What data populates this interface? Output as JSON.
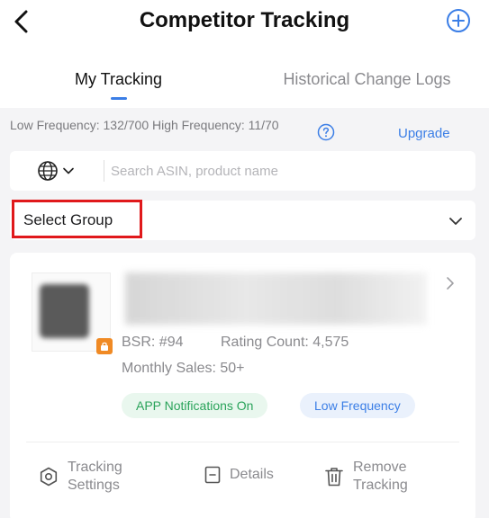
{
  "header": {
    "title": "Competitor Tracking"
  },
  "tabs": [
    {
      "label": "My Tracking",
      "active": true
    },
    {
      "label": "Historical Change Logs",
      "active": false
    }
  ],
  "quota": {
    "text": "Low Frequency: 132/700 High Frequency: 11/70",
    "upgrade_label": "Upgrade"
  },
  "search": {
    "placeholder": "Search ASIN, product name",
    "value": ""
  },
  "group_select": {
    "label": "Select Group"
  },
  "product_card": {
    "bsr": "BSR: #94",
    "rating_count": "Rating Count: 4,575",
    "monthly_sales": "Monthly Sales: 50+",
    "tags": {
      "notifications": "APP Notifications On",
      "frequency": "Low Frequency"
    },
    "actions": {
      "tracking_settings": "Tracking Settings",
      "details": "Details",
      "remove_tracking": "Remove Tracking"
    }
  },
  "colors": {
    "accent": "#3b7ee6",
    "highlight": "#e0191b",
    "tag_green_text": "#2aa35a",
    "tag_green_bg": "#e9f7ee",
    "badge_orange": "#f08a24"
  },
  "icons": [
    "back-arrow-icon",
    "add-circle-icon",
    "help-circle-icon",
    "globe-icon",
    "chevron-down-icon",
    "chevron-right-icon",
    "settings-icon",
    "details-icon",
    "trash-icon"
  ]
}
